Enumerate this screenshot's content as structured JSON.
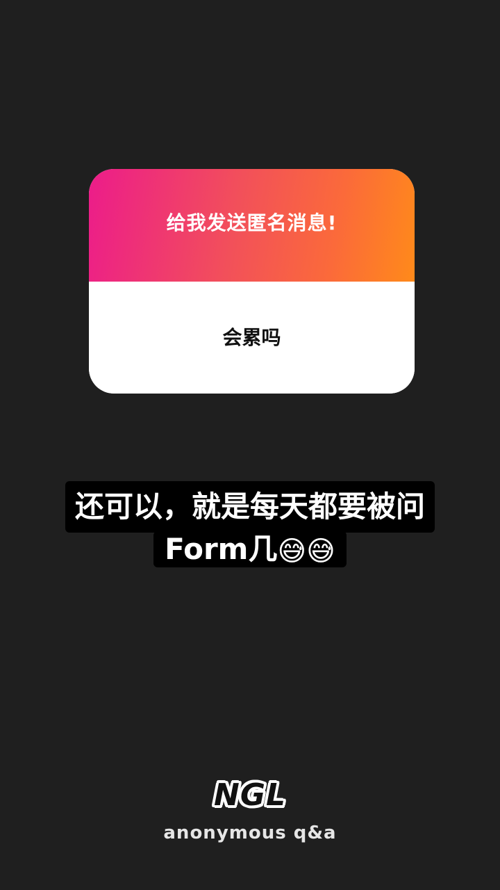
{
  "card": {
    "prompt": "给我发送匿名消息!",
    "message": "会累吗"
  },
  "caption": {
    "line1": "还可以，就是每天都要被问",
    "line2_text": "Form几",
    "line2_emoji": "😅😅"
  },
  "brand": {
    "logo": "NGL",
    "tagline": "anonymous q&a"
  },
  "colors": {
    "background": "#1f1f1f",
    "gradient_start": "#ec1c8a",
    "gradient_end": "#ff8a1a"
  }
}
